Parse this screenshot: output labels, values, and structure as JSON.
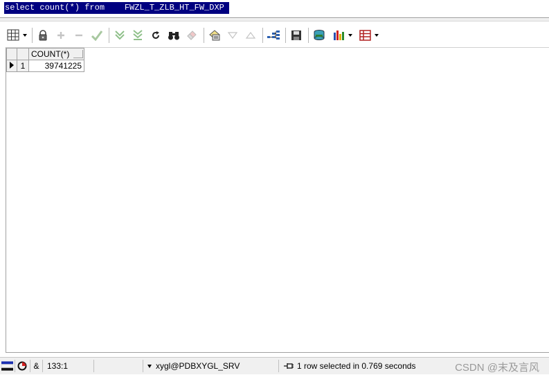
{
  "editor": {
    "sql_text": "select count(*) from    FWZL_T_ZLB_HT_FW_DXP"
  },
  "toolbar": {
    "buttons": [
      {
        "name": "grid-view-icon"
      },
      {
        "name": "lock-icon"
      },
      {
        "name": "add-record-icon"
      },
      {
        "name": "delete-record-icon"
      },
      {
        "name": "post-changes-icon"
      },
      {
        "name": "fetch-next-page-icon"
      },
      {
        "name": "fetch-last-page-icon"
      },
      {
        "name": "refresh-icon"
      },
      {
        "name": "find-binoculars-icon"
      },
      {
        "name": "clear-eraser-icon"
      },
      {
        "name": "query-by-example-icon"
      },
      {
        "name": "sort-descending-icon"
      },
      {
        "name": "sort-ascending-icon"
      },
      {
        "name": "explain-plan-icon"
      },
      {
        "name": "save-icon"
      },
      {
        "name": "export-icon"
      },
      {
        "name": "chart-icon"
      },
      {
        "name": "single-record-view-icon"
      }
    ]
  },
  "results": {
    "columns": [
      "COUNT(*)"
    ],
    "rows": [
      {
        "row_number": "1",
        "values": [
          "39741225"
        ]
      }
    ]
  },
  "status": {
    "cursor_position": "133:1",
    "ampersand": "&",
    "connection": "xygl@PDBXYGL_SRV",
    "message": "1 row selected in 0.769 seconds",
    "watermark": "CSDN @末及言风"
  }
}
